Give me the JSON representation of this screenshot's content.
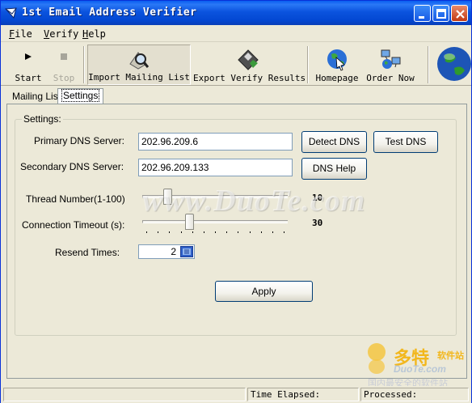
{
  "window": {
    "title": "1st Email Address Verifier"
  },
  "menu": [
    "File",
    "Verify",
    "Help"
  ],
  "toolbar": {
    "start": "Start",
    "stop": "Stop",
    "import": "Import Mailing List",
    "export": "Export Verify Results",
    "homepage": "Homepage",
    "order": "Order Now"
  },
  "tabs": [
    "Mailing List",
    "Settings"
  ],
  "settings": {
    "group_title": "Settings:",
    "primary_dns_label": "Primary DNS Server:",
    "primary_dns_value": "202.96.209.6",
    "secondary_dns_label": "Secondary DNS Server:",
    "secondary_dns_value": "202.96.209.133",
    "detect_dns": "Detect DNS",
    "test_dns": "Test DNS",
    "dns_help": "DNS Help",
    "thread_label": "Thread Number(1-100)",
    "thread_value": "10",
    "timeout_label": "Connection Timeout (s):",
    "timeout_value": "30",
    "resend_label": "Resend Times:",
    "resend_value": "2",
    "apply": "Apply"
  },
  "sliders": {
    "thread": {
      "value": 10,
      "min": 1,
      "max": 100
    },
    "timeout": {
      "value": 30,
      "min": 0,
      "max": 120
    }
  },
  "status": {
    "time_elapsed": "Time Elapsed:",
    "processed": "Processed:"
  },
  "watermarks": {
    "center": "www.DuoTe.com",
    "logo_cn": "多特",
    "logo_cn2": "软件站",
    "logo_en": "DuoTe.com",
    "logo_tag": "国内最安全的软件站"
  },
  "colors": {
    "titlebar": "#0b53de",
    "window_bg": "#ece9d8",
    "slider_value": "#000000"
  }
}
